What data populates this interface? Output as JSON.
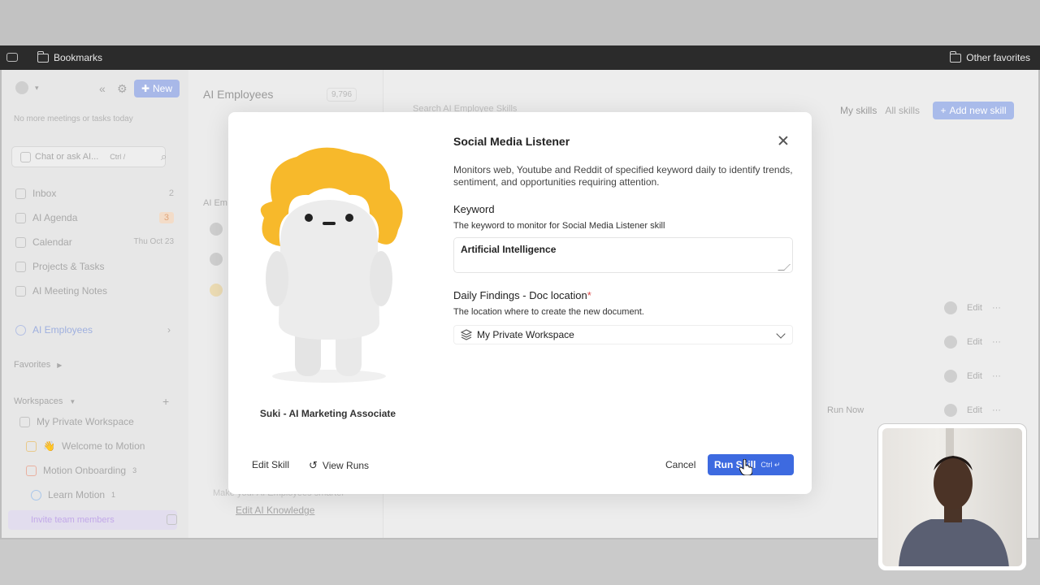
{
  "browser": {
    "bookmarks_label": "Bookmarks",
    "other_favorites_label": "Other favorites"
  },
  "sidebar": {
    "new_label": "New",
    "schedule_note": "No more meetings or tasks today",
    "chat_placeholder": "Chat or ask AI...",
    "chat_shortcut": "Ctrl /",
    "nav": [
      {
        "label": "Inbox",
        "count": "2"
      },
      {
        "label": "AI Agenda",
        "count": "3"
      },
      {
        "label": "Calendar",
        "count": "Thu Oct 23"
      },
      {
        "label": "Projects & Tasks",
        "count": ""
      },
      {
        "label": "AI Meeting Notes",
        "count": ""
      },
      {
        "label": "AI Employees",
        "count": ""
      }
    ],
    "favorites_label": "Favorites",
    "workspaces_label": "Workspaces",
    "workspaces": [
      {
        "label": "My Private Workspace"
      },
      {
        "label": "Welcome to Motion"
      },
      {
        "label": "Motion Onboarding",
        "count": "3"
      },
      {
        "label": "Learn Motion",
        "count": "1"
      }
    ],
    "invite_label": "Invite team members"
  },
  "middle": {
    "title": "AI Employees",
    "badge": "9,796",
    "section_label": "AI Em",
    "footer_note": "Make your AI Employees smarter",
    "edit_knowledge": "Edit AI Knowledge"
  },
  "right": {
    "search_placeholder": "Search AI Employee Skills",
    "tab_my": "My skills",
    "tab_all": "All skills",
    "add_skill": "Add new skill",
    "edit_label": "Edit",
    "run_now": "Run Now"
  },
  "modal": {
    "title": "Social Media Listener",
    "description": "Monitors web, Youtube and Reddit of specified keyword daily to identify trends, sentiment, and opportunities requiring attention.",
    "keyword_label": "Keyword",
    "keyword_help": "The keyword to monitor for Social Media Listener skill",
    "keyword_value": "Artificial Intelligence",
    "doc_label": "Daily Findings - Doc location",
    "doc_required_mark": "*",
    "doc_help": "The location where to create the new document.",
    "doc_value": "My Private Workspace",
    "mascot_name": "Suki - AI Marketing Associate",
    "edit_skill": "Edit Skill",
    "view_runs": "View Runs",
    "cancel": "Cancel",
    "run_skill": "Run Skill",
    "run_shortcut": "Ctrl ↵"
  },
  "colors": {
    "primary": "#3d6ae0",
    "mascot_hair": "#f7b92b"
  }
}
